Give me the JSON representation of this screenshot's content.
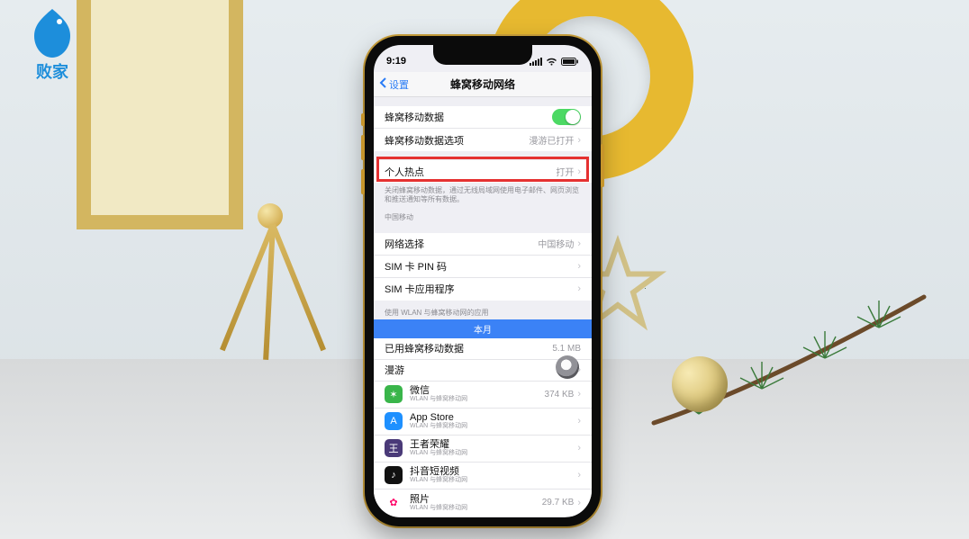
{
  "logo_text": "败家",
  "phone": {
    "status": {
      "time": "9:19"
    },
    "nav": {
      "back": "设置",
      "title": "蜂窝移动网络"
    },
    "group1": {
      "cellular_data": "蜂窝移动数据",
      "options": "蜂窝移动数据选项",
      "options_value": "漫游已打开"
    },
    "hotspot": {
      "label": "个人热点",
      "value": "打开"
    },
    "note": "关闭蜂窝移动数据，通过无线局域网使用电子邮件、网页浏览和推送通知等所有数据。",
    "carrier_header": "中国移动",
    "group2": {
      "network_select": "网络选择",
      "network_value": "中国移动",
      "sim_pin": "SIM 卡 PIN 码",
      "sim_apps": "SIM 卡应用程序"
    },
    "apps_header": "使用 WLAN 与蜂窝移动网的应用",
    "month": "本月",
    "used": {
      "label": "已用蜂窝移动数据",
      "value": "5.1 MB"
    },
    "roaming": "漫游",
    "apps": [
      {
        "name": "微信",
        "sub": "WLAN 与蜂窝移动网",
        "value": "374 KB",
        "bg": "#39b54a",
        "glyph": "✶"
      },
      {
        "name": "App Store",
        "sub": "WLAN 与蜂窝移动网",
        "value": "",
        "bg": "#1e90ff",
        "glyph": "A"
      },
      {
        "name": "王者荣耀",
        "sub": "WLAN 与蜂窝移动网",
        "value": "",
        "bg": "#4a3a78",
        "glyph": "王"
      },
      {
        "name": "抖音短视频",
        "sub": "WLAN 与蜂窝移动网",
        "value": "",
        "bg": "#111111",
        "glyph": "♪"
      },
      {
        "name": "照片",
        "sub": "WLAN 与蜂窝移动网",
        "value": "29.7 KB",
        "bg": "#ffffff",
        "glyph": "✿"
      }
    ]
  }
}
